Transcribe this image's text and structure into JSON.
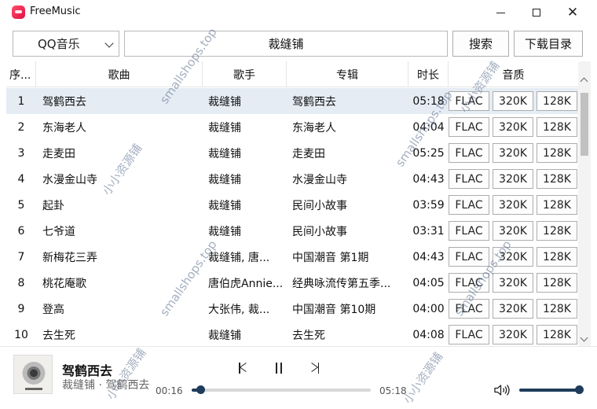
{
  "window": {
    "title": "FreeMusic"
  },
  "search": {
    "source": "QQ音乐",
    "query": "裁缝铺",
    "search_label": "搜索",
    "download_dir_label": "下载目录"
  },
  "table": {
    "headers": {
      "no": "序...",
      "song": "歌曲",
      "artist": "歌手",
      "album": "专辑",
      "duration": "时长",
      "quality": "音质"
    },
    "quality_labels": [
      "FLAC",
      "320K",
      "128K"
    ],
    "rows": [
      {
        "no": "1",
        "song": "驾鹤西去",
        "artist": "裁缝铺",
        "album": "驾鹤西去",
        "duration": "05:18"
      },
      {
        "no": "2",
        "song": "东海老人",
        "artist": "裁缝铺",
        "album": "东海老人",
        "duration": "04:04"
      },
      {
        "no": "3",
        "song": "走麦田",
        "artist": "裁缝铺",
        "album": "走麦田",
        "duration": "05:25"
      },
      {
        "no": "4",
        "song": "水漫金山寺",
        "artist": "裁缝铺",
        "album": "水漫金山寺",
        "duration": "04:43"
      },
      {
        "no": "5",
        "song": "起卦",
        "artist": "裁缝铺",
        "album": "民间小故事",
        "duration": "03:59"
      },
      {
        "no": "6",
        "song": "七爷道",
        "artist": "裁缝铺",
        "album": "民间小故事",
        "duration": "03:31"
      },
      {
        "no": "7",
        "song": "新梅花三弄",
        "artist": "裁缝铺, 唐...",
        "album": "中国潮音 第1期",
        "duration": "04:43"
      },
      {
        "no": "8",
        "song": "桃花庵歌",
        "artist": "唐伯虎Annie...",
        "album": "经典咏流传第五季...",
        "duration": "04:05"
      },
      {
        "no": "9",
        "song": "登高",
        "artist": "大张伟, 裁...",
        "album": "中国潮音 第10期",
        "duration": "04:00"
      },
      {
        "no": "10",
        "song": "去生死",
        "artist": "裁缝铺",
        "album": "去生死",
        "duration": "04:08"
      }
    ],
    "selected_row": 0
  },
  "player": {
    "title": "驾鹤西去",
    "subtitle": "裁缝铺 · 驾鹤西去",
    "current_time": "00:16",
    "total_time": "05:18",
    "progress": 0.05,
    "volume": 1.0
  },
  "watermarks": [
    "smallshops.top",
    "小小资源铺",
    "smallshops.top",
    "小小资源铺",
    "smallshops.top",
    "小小资源铺",
    "smallshops.top",
    "小小资源铺"
  ],
  "colors": {
    "accent": "#1f3c5b",
    "selected_row": "#e5ecf4",
    "app_icon": "#e0113f"
  }
}
